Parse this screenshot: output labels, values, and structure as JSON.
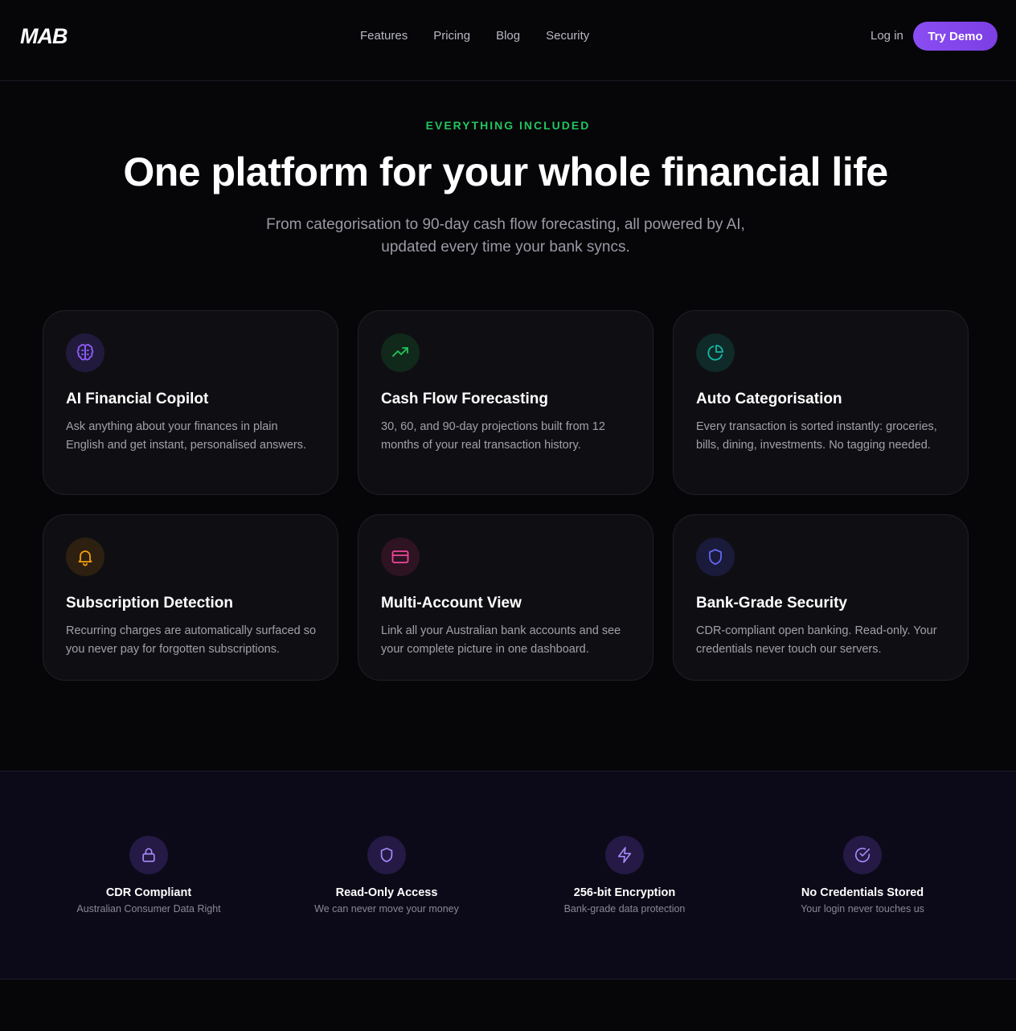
{
  "brand": {
    "logo_text": "MAB"
  },
  "nav": {
    "links": [
      "Features",
      "Pricing",
      "Blog",
      "Security"
    ],
    "login_label": "Log in",
    "cta_label": "Try Demo"
  },
  "hero": {
    "eyebrow": "EVERYTHING INCLUDED",
    "title": "One platform for your whole financial life",
    "subtitle_line1": "From categorisation to 90-day cash flow forecasting, all powered by AI,",
    "subtitle_line2": "updated every time your bank syncs."
  },
  "features": [
    {
      "icon": "brain-icon",
      "accent": "#8b5cf6",
      "title": "AI Financial Copilot",
      "description": "Ask anything about your finances in plain English and get instant, personalised answers."
    },
    {
      "icon": "trending-up-icon",
      "accent": "#22c55e",
      "title": "Cash Flow Forecasting",
      "description": "30, 60, and 90-day projections built from 12 months of your real transaction history."
    },
    {
      "icon": "pie-chart-icon",
      "accent": "#14b8a6",
      "title": "Auto Categorisation",
      "description": "Every transaction is sorted instantly: groceries, bills, dining, investments. No tagging needed."
    },
    {
      "icon": "bell-icon",
      "accent": "#f59e0b",
      "title": "Subscription Detection",
      "description": "Recurring charges are automatically surfaced so you never pay for forgotten subscriptions."
    },
    {
      "icon": "credit-card-icon",
      "accent": "#ec4899",
      "title": "Multi-Account View",
      "description": "Link all your Australian bank accounts and see your complete picture in one dashboard."
    },
    {
      "icon": "shield-icon",
      "accent": "#6366f1",
      "title": "Bank-Grade Security",
      "description": "CDR-compliant open banking. Read-only. Your credentials never touch our servers."
    }
  ],
  "trust": [
    {
      "icon": "lock-icon",
      "title": "CDR Compliant",
      "subtitle": "Australian Consumer Data Right"
    },
    {
      "icon": "shield-icon",
      "title": "Read-Only Access",
      "subtitle": "We can never move your money"
    },
    {
      "icon": "zap-icon",
      "title": "256-bit Encryption",
      "subtitle": "Bank-grade data protection"
    },
    {
      "icon": "check-circle-icon",
      "title": "No Credentials Stored",
      "subtitle": "Your login never touches us"
    }
  ],
  "colors": {
    "background": "#060609",
    "accent_purple": "#8b5cf6",
    "eyebrow_green": "#22c55e"
  }
}
